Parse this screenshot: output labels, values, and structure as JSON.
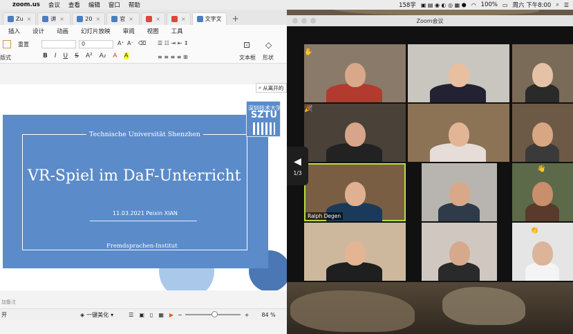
{
  "menubar": {
    "app": "zoom.us",
    "items": [
      "会议",
      "查看",
      "编辑",
      "窗口",
      "帮助"
    ],
    "status_count": "158字",
    "battery": "100%",
    "clock": "周六 下午8:00"
  },
  "wps": {
    "tabs": [
      {
        "label": "Zu",
        "color": "#4a7ec0"
      },
      {
        "label": "讲",
        "color": "#4a7ec0"
      },
      {
        "label": "20",
        "color": "#4a7ec0"
      },
      {
        "label": "官",
        "color": "#4a7ec0"
      },
      {
        "label": "",
        "color": "#d9473a"
      },
      {
        "label": "",
        "color": "#d9473a"
      },
      {
        "label": "文字文",
        "color": "#4a7ec0"
      }
    ],
    "tab_add": "+",
    "ribbon_menu": [
      "插入",
      "设计",
      "动画",
      "幻灯片放映",
      "审阅",
      "视图",
      "工具"
    ],
    "ribbon": {
      "reset": "重置",
      "layout": "版式",
      "font_size": "0",
      "text_box": "文本框",
      "shape": "形状",
      "format_marks": [
        "B",
        "I",
        "U",
        "S",
        "A²",
        "A₂",
        "A",
        "A"
      ]
    },
    "search_hint": "从离开的",
    "slide": {
      "top_text": "Technische Universität Shenzhen",
      "title": "VR-Spiel im DaF-Unterricht",
      "date_author": "11.03.2021  Peixin XIAN",
      "bottom_text": "Fremdsprachen-Institut",
      "logo_cn": "深圳技术大学",
      "logo_en": "SZTU"
    },
    "notes_hint": "加备注",
    "status": {
      "left": "开",
      "beautify": "一键美化",
      "zoom": "84 %"
    }
  },
  "zoom": {
    "title": "Zoom会议",
    "page": "1/3",
    "participants": [
      {
        "name": "",
        "bg": "#8a7a6a",
        "skin": "#d9a88a",
        "shirt": "#b33a2e"
      },
      {
        "name": "",
        "bg": "#c9c6c0",
        "skin": "#e8c0a0",
        "shirt": "#223"
      },
      {
        "name": "",
        "bg": "#7a6a58",
        "skin": "#e5c2a5",
        "shirt": "#2a2a2a"
      },
      {
        "name": "",
        "bg": "#4a4138",
        "skin": "#d8a58a",
        "shirt": "#222"
      },
      {
        "name": "",
        "bg": "#8c7355",
        "skin": "#e2b596",
        "shirt": "#e6ddd8"
      },
      {
        "name": "",
        "bg": "#6d5a46",
        "skin": "#d9a684",
        "shirt": "#3a3a3a"
      },
      {
        "name": "Ralph Degen",
        "bg": "#7a5e44",
        "skin": "#e0b092",
        "shirt": "#1b3a5a"
      },
      {
        "name": "",
        "bg": "#b8b5b0",
        "skin": "#d8a888",
        "shirt": "#2f3a4a"
      },
      {
        "name": "",
        "bg": "#5d6a4a",
        "skin": "#c98f6c",
        "shirt": "#5a3a2a"
      },
      {
        "name": "",
        "bg": "#cdb89e",
        "skin": "#e4b592",
        "shirt": "#1f1f1f"
      },
      {
        "name": "",
        "bg": "#d0c8c0",
        "skin": "#d7a98c",
        "shirt": "#2a2a2a"
      },
      {
        "name": "",
        "bg": "#e5e5e5",
        "skin": "#dcb49a",
        "shirt": "#f4f4f4"
      }
    ],
    "active_speaker": "Ralph Degen"
  }
}
